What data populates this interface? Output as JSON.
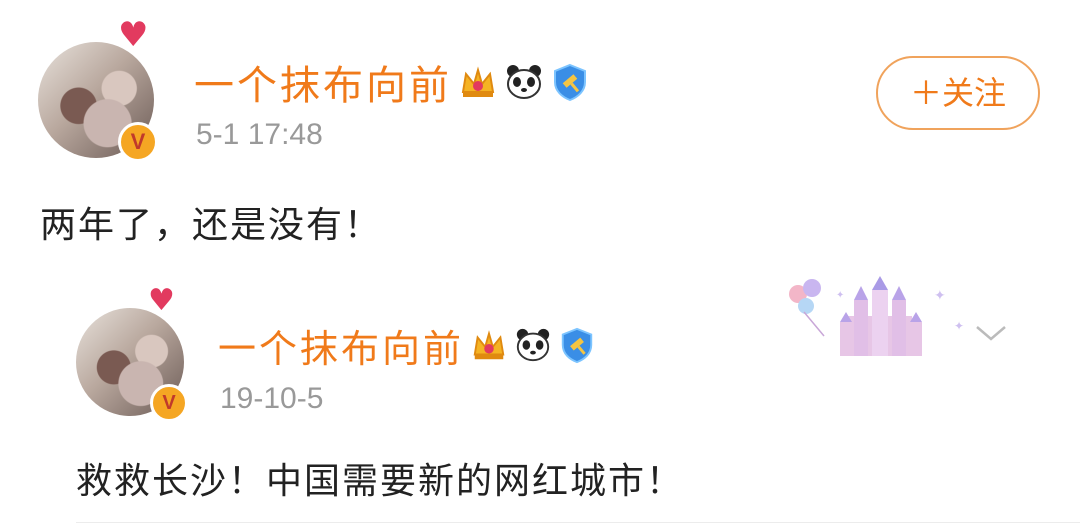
{
  "post": {
    "author": "一个抹布向前",
    "timestamp": "5-1 17:48",
    "follow_label": "＋关注",
    "content": "两年了，还是没有！",
    "badges": [
      "crown-icon",
      "panda-icon",
      "gavel-shield-icon"
    ]
  },
  "quoted": {
    "author": "一个抹布向前",
    "timestamp": "19-10-5",
    "content": "救救长沙！中国需要新的网红城市！",
    "badges": [
      "crown-icon",
      "panda-icon",
      "gavel-shield-icon"
    ]
  },
  "colors": {
    "name": "#f07a1a",
    "verified": "#f5a623",
    "heart": "#e23a5f"
  }
}
